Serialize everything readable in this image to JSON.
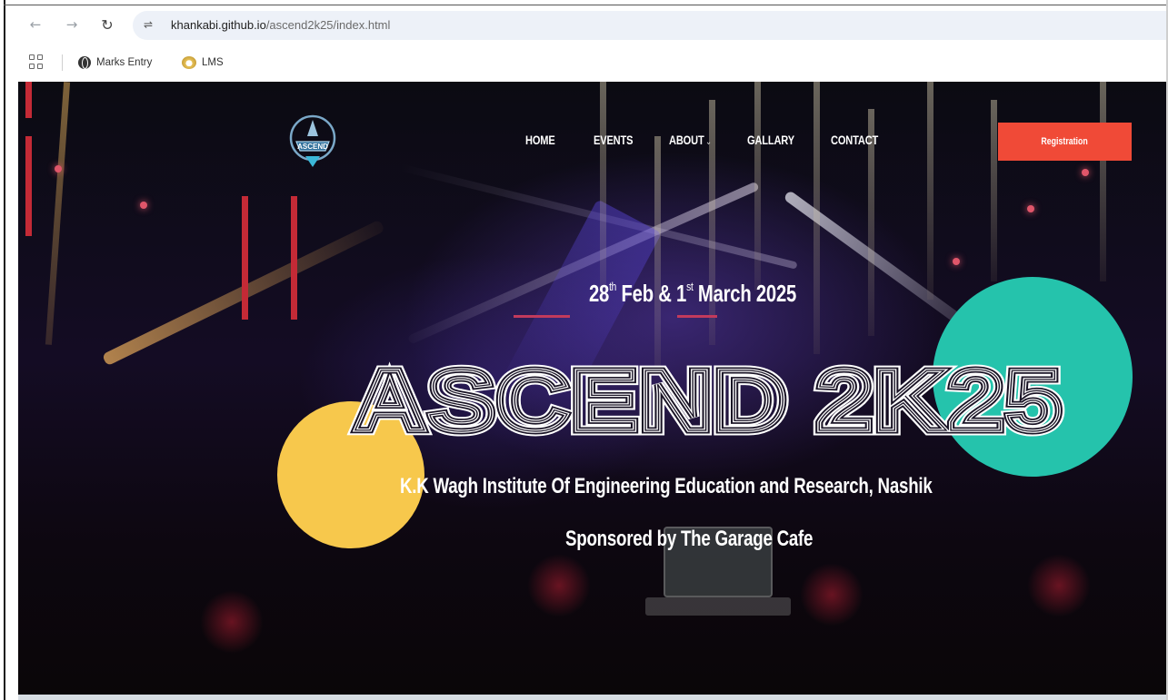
{
  "browser": {
    "url_host": "khankabi.github.io",
    "url_path": "/ascend2k25/index.html",
    "back_icon": "arrow-left",
    "forward_icon": "arrow-right",
    "reload_icon": "reload"
  },
  "bookmarks": {
    "items": [
      {
        "label": "Marks Entry",
        "icon": "globe-icon"
      },
      {
        "label": "LMS",
        "icon": "lms-icon"
      }
    ]
  },
  "site": {
    "logo_text": "ASCEND",
    "nav": [
      {
        "label": "HOME"
      },
      {
        "label": "EVENTS"
      },
      {
        "label": "ABOUT",
        "has_dropdown": true
      },
      {
        "label": "GALLARY"
      },
      {
        "label": "CONTACT"
      }
    ],
    "register_label": "Registration",
    "colors": {
      "register_bg": "#f04a37",
      "teal_circle": "#25c3ac",
      "yellow_circle": "#f7c84c"
    }
  },
  "hero": {
    "date_day1": "28",
    "date_sup1": "th",
    "date_mid": " Feb & 1",
    "date_sup2": "st",
    "date_end": " March 2025",
    "title": "ASCEND 2K25",
    "subtitle": "K.K Wagh Institute Of Engineering Education and Research, Nashik",
    "sponsor": "Sponsored by The Garage Cafe"
  }
}
